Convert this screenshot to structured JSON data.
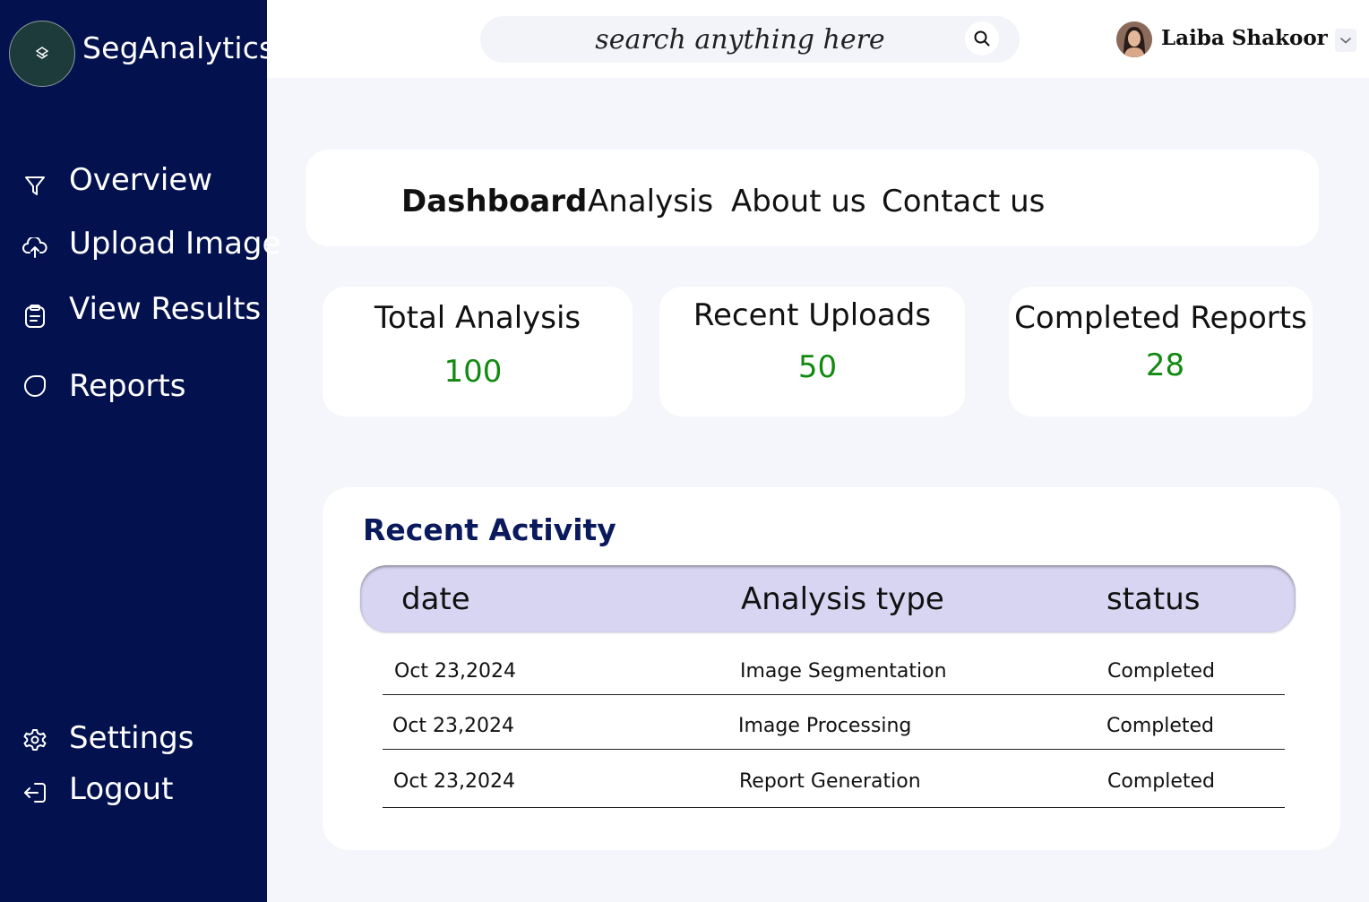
{
  "sidebar": {
    "brand": "SegAnalytics",
    "items": [
      {
        "label": "Overview",
        "icon": "filter-icon"
      },
      {
        "label": "Upload Image",
        "icon": "cloud-upload-icon"
      },
      {
        "label": "View Results",
        "icon": "clipboard-icon"
      },
      {
        "label": "Reports",
        "icon": "pie-chart-icon"
      }
    ],
    "bottom_items": [
      {
        "label": "Settings",
        "icon": "gear-icon"
      },
      {
        "label": "Logout",
        "icon": "logout-icon"
      }
    ]
  },
  "header": {
    "search_placeholder": "search anything here",
    "user_name": "Laiba Shakoor"
  },
  "tabs": [
    {
      "label": "Dashboard",
      "active": true
    },
    {
      "label": "Analysis",
      "active": false
    },
    {
      "label": "About us",
      "active": false
    },
    {
      "label": "Contact us",
      "active": false
    }
  ],
  "stats": [
    {
      "title": "Total Analysis",
      "value": "100"
    },
    {
      "title": "Recent Uploads",
      "value": "50"
    },
    {
      "title": "Completed Reports",
      "value": "28"
    }
  ],
  "activity": {
    "title": "Recent Activity",
    "columns": [
      "date",
      "Analysis type",
      "status"
    ],
    "rows": [
      [
        "Oct 23,2024",
        "Image Segmentation",
        "Completed"
      ],
      [
        "Oct 23,2024",
        "Image Processing",
        "Completed"
      ],
      [
        "Oct 23,2024",
        "Report Generation",
        "Completed"
      ]
    ]
  },
  "colors": {
    "sidebar": "#03124e",
    "stat_value": "#128a12",
    "table_header": "#d7d5f1",
    "activity_title": "#0a1a5c"
  }
}
